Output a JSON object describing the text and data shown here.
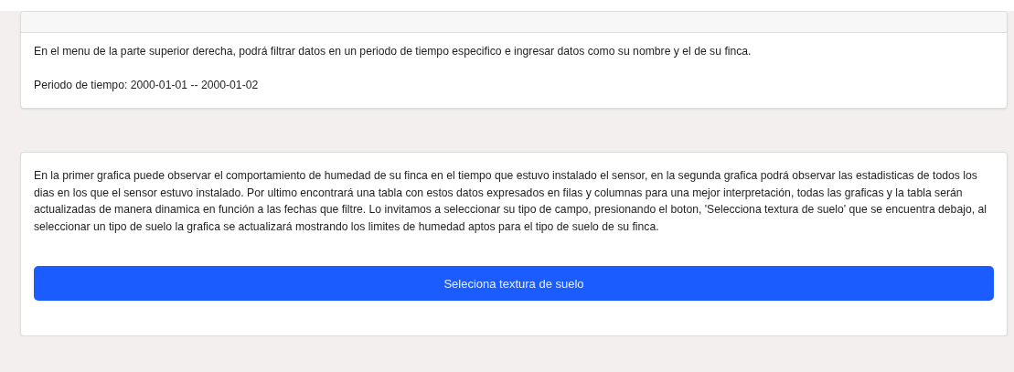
{
  "info_card": {
    "lines": [
      "En el menu de la parte superior derecha, podrá filtrar datos en un periodo de tiempo especifico e ingresar datos como su nombre y el de su finca.",
      "Periodo de tiempo: 2000-01-01 -- 2000-01-02"
    ]
  },
  "soil_card": {
    "description": "En la primer grafica puede observar el comportamiento de humedad de su finca en el tiempo que estuvo instalado el sensor, en la segunda grafica podrá observar las estadisticas de todos los dias en los que el sensor estuvo instalado. Por ultimo encontrará una tabla con estos datos expresados en filas y columnas para una mejor interpretación, todas las graficas y la tabla serán actualizadas de manera dinamica en función a las fechas que filtre. Lo invitamos a seleccionar su tipo de campo, presionando el boton, 'Selecciona textura de suelo' que se encuentra debajo, al seleccionar un tipo de suelo la grafica se actualizará mostrando los limites de humedad aptos para el tipo de suelo de su finca.",
    "button": "Seleciona textura de suelo"
  }
}
